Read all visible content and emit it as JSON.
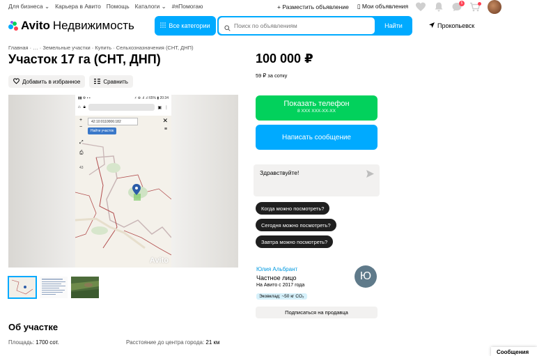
{
  "topbar": {
    "links": [
      "Для бизнеса",
      "Карьера в Авито",
      "Помощь",
      "Каталоги",
      "#яПомогаю"
    ],
    "post_ad": "Разместить объявление",
    "my_ads": "Мои объявления",
    "notifications_badge": "5"
  },
  "header": {
    "logo_brand": "Avito",
    "logo_section": "Недвижимость",
    "categories_label": "Все категории",
    "search_placeholder": "Поиск по объявлениям",
    "search_button": "Найти",
    "location": "Прокопьевск"
  },
  "breadcrumb": "Главная  ·  …  ·  Земельные участки  ·  Купить  ·  Сельхозназначения (СНТ, ДНП)",
  "listing": {
    "title": "Участок 17 га (СНТ, ДНП)",
    "favorite_label": "Добавить в избранное",
    "compare_label": "Сравнить",
    "price": "100 000 ₽",
    "price_per": "59 ₽ за сотку"
  },
  "gallery": {
    "phone_status_left": "▮▮ ⚙ ▪ ▪",
    "phone_status_right": "⚡ ⊕ .ıl .ıl 65% ▮ 20:34",
    "map_coords": "42:10:0110006:182",
    "map_find": "Найти участок",
    "map_side_number": "43",
    "watermark": "Avito"
  },
  "contact": {
    "show_phone": "Показать телефон",
    "phone_mask": "8 XXX XXX-XX-XX",
    "write_message": "Написать сообщение",
    "chat_greeting": "Здравствуйте!",
    "quick_replies": [
      "Когда можно посмотреть?",
      "Сегодня можно посмотреть?",
      "Завтра можно посмотреть?"
    ]
  },
  "seller": {
    "name": "Юлия Альбрант",
    "type": "Частное лицо",
    "since": "На Авито с 2017 года",
    "eco": "Эковклад: ~50 кг CO₂",
    "avatar_letter": "Ю",
    "subscribe": "Подписаться на продавца"
  },
  "about": {
    "title": "Об участке",
    "area_label": "Площадь:",
    "area_value": "1700 сот.",
    "distance_label": "Расстояние до центра города:",
    "distance_value": "21 км"
  },
  "messages_tab": "Сообщения",
  "colors": {
    "accent_blue": "#00aaff",
    "accent_green": "#02d15c",
    "dark_chip": "#1f1f1f",
    "badge_red": "#ff4053"
  }
}
